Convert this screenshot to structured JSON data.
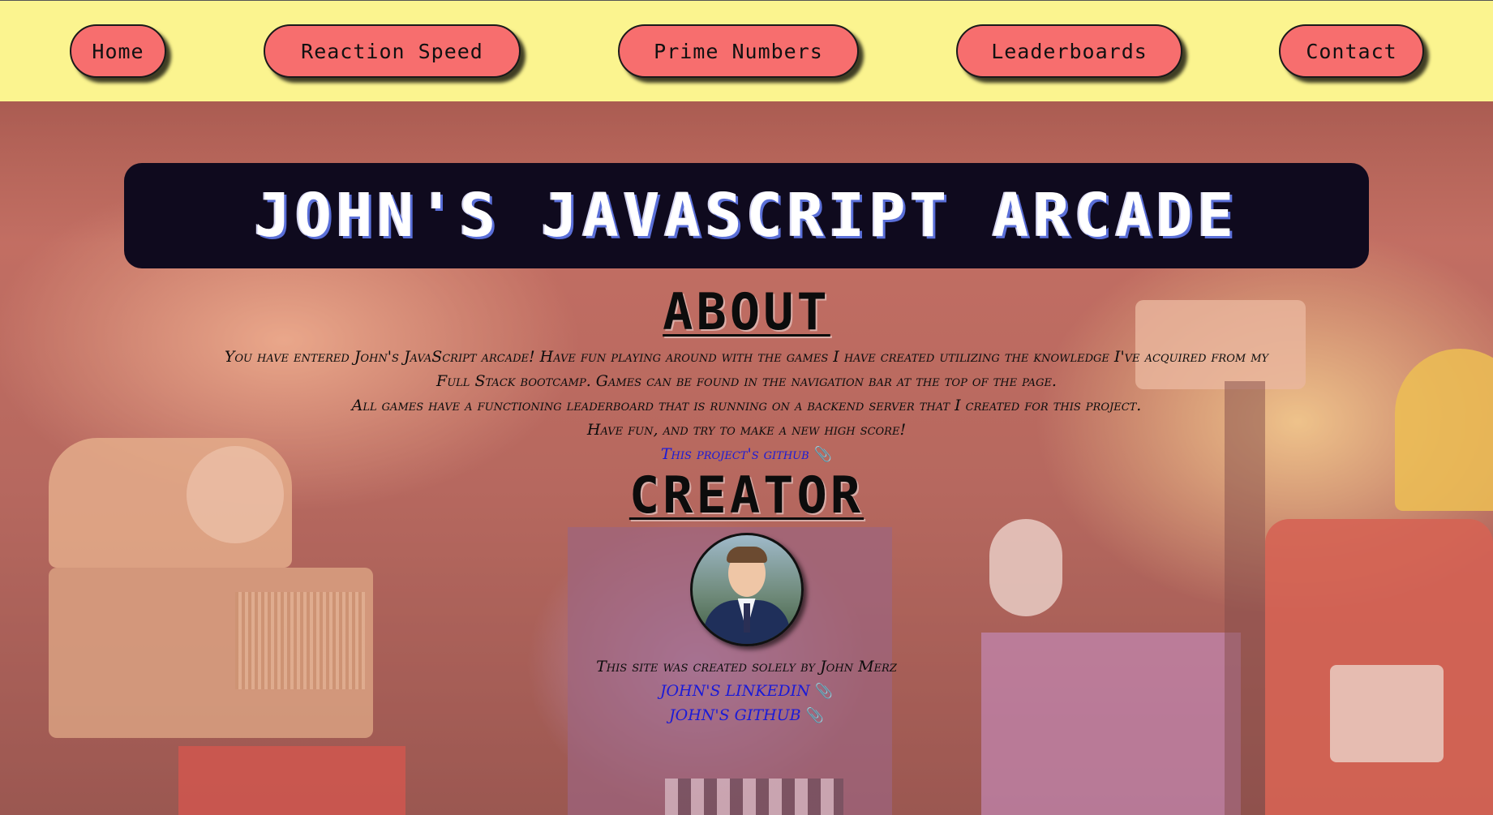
{
  "nav": {
    "home": "Home",
    "reaction": "Reaction Speed",
    "prime": "Prime Numbers",
    "leaderboards": "Leaderboards",
    "contact": "Contact"
  },
  "title": "JOHN'S JAVASCRIPT ARCADE",
  "about": {
    "heading": "ABOUT",
    "line1": "You have entered John's JavaScript arcade! Have fun playing around with the games I have created utilizing the knowledge I've acquired from my Full Stack bootcamp. Games can be found in the navigation bar at the top of the page.",
    "line2": "All games have a functioning leaderboard that is running on a backend server that I created for this project.",
    "line3": "Have fun, and try to make a new high score!",
    "github_link": "This project's github",
    "link_icon": "📎"
  },
  "creator": {
    "heading": "CREATOR",
    "credit": "This site was created solely by John Merz",
    "linkedin_link": "JOHN'S LINKEDIN",
    "github_link": "JOHN'S GITHUB",
    "link_icon": "📎"
  },
  "colors": {
    "nav_bg": "#fbf48f",
    "nav_button": "#f76e6e",
    "banner_bg": "#0f0a1e",
    "link": "#1a1ad8"
  }
}
